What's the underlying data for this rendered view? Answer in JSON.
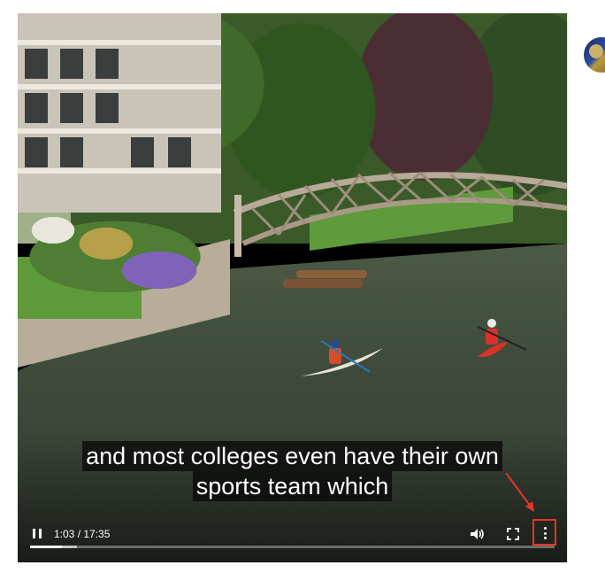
{
  "video": {
    "captions": [
      "and most colleges even have their own",
      "sports team which"
    ],
    "time_display": "1:03 / 17:35",
    "current_time": "1:03",
    "duration": "17:35",
    "progress_fraction": 0.06,
    "buffered_fraction": 0.09
  },
  "controls": {
    "play_state": "playing",
    "pause_icon": "pause-icon",
    "volume_icon": "volume-icon",
    "fullscreen_icon": "fullscreen-icon",
    "more_icon": "more-vertical-icon"
  },
  "annotation": {
    "highlight_color": "#e53526",
    "target": "more-options-button"
  }
}
